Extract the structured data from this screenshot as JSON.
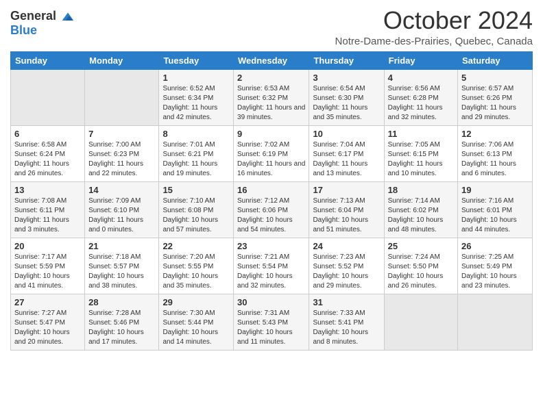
{
  "logo": {
    "general": "General",
    "blue": "Blue"
  },
  "title": "October 2024",
  "location": "Notre-Dame-des-Prairies, Quebec, Canada",
  "weekdays": [
    "Sunday",
    "Monday",
    "Tuesday",
    "Wednesday",
    "Thursday",
    "Friday",
    "Saturday"
  ],
  "weeks": [
    [
      {
        "day": "",
        "info": ""
      },
      {
        "day": "",
        "info": ""
      },
      {
        "day": "1",
        "info": "Sunrise: 6:52 AM\nSunset: 6:34 PM\nDaylight: 11 hours and 42 minutes."
      },
      {
        "day": "2",
        "info": "Sunrise: 6:53 AM\nSunset: 6:32 PM\nDaylight: 11 hours and 39 minutes."
      },
      {
        "day": "3",
        "info": "Sunrise: 6:54 AM\nSunset: 6:30 PM\nDaylight: 11 hours and 35 minutes."
      },
      {
        "day": "4",
        "info": "Sunrise: 6:56 AM\nSunset: 6:28 PM\nDaylight: 11 hours and 32 minutes."
      },
      {
        "day": "5",
        "info": "Sunrise: 6:57 AM\nSunset: 6:26 PM\nDaylight: 11 hours and 29 minutes."
      }
    ],
    [
      {
        "day": "6",
        "info": "Sunrise: 6:58 AM\nSunset: 6:24 PM\nDaylight: 11 hours and 26 minutes."
      },
      {
        "day": "7",
        "info": "Sunrise: 7:00 AM\nSunset: 6:23 PM\nDaylight: 11 hours and 22 minutes."
      },
      {
        "day": "8",
        "info": "Sunrise: 7:01 AM\nSunset: 6:21 PM\nDaylight: 11 hours and 19 minutes."
      },
      {
        "day": "9",
        "info": "Sunrise: 7:02 AM\nSunset: 6:19 PM\nDaylight: 11 hours and 16 minutes."
      },
      {
        "day": "10",
        "info": "Sunrise: 7:04 AM\nSunset: 6:17 PM\nDaylight: 11 hours and 13 minutes."
      },
      {
        "day": "11",
        "info": "Sunrise: 7:05 AM\nSunset: 6:15 PM\nDaylight: 11 hours and 10 minutes."
      },
      {
        "day": "12",
        "info": "Sunrise: 7:06 AM\nSunset: 6:13 PM\nDaylight: 11 hours and 6 minutes."
      }
    ],
    [
      {
        "day": "13",
        "info": "Sunrise: 7:08 AM\nSunset: 6:11 PM\nDaylight: 11 hours and 3 minutes."
      },
      {
        "day": "14",
        "info": "Sunrise: 7:09 AM\nSunset: 6:10 PM\nDaylight: 11 hours and 0 minutes."
      },
      {
        "day": "15",
        "info": "Sunrise: 7:10 AM\nSunset: 6:08 PM\nDaylight: 10 hours and 57 minutes."
      },
      {
        "day": "16",
        "info": "Sunrise: 7:12 AM\nSunset: 6:06 PM\nDaylight: 10 hours and 54 minutes."
      },
      {
        "day": "17",
        "info": "Sunrise: 7:13 AM\nSunset: 6:04 PM\nDaylight: 10 hours and 51 minutes."
      },
      {
        "day": "18",
        "info": "Sunrise: 7:14 AM\nSunset: 6:02 PM\nDaylight: 10 hours and 48 minutes."
      },
      {
        "day": "19",
        "info": "Sunrise: 7:16 AM\nSunset: 6:01 PM\nDaylight: 10 hours and 44 minutes."
      }
    ],
    [
      {
        "day": "20",
        "info": "Sunrise: 7:17 AM\nSunset: 5:59 PM\nDaylight: 10 hours and 41 minutes."
      },
      {
        "day": "21",
        "info": "Sunrise: 7:18 AM\nSunset: 5:57 PM\nDaylight: 10 hours and 38 minutes."
      },
      {
        "day": "22",
        "info": "Sunrise: 7:20 AM\nSunset: 5:55 PM\nDaylight: 10 hours and 35 minutes."
      },
      {
        "day": "23",
        "info": "Sunrise: 7:21 AM\nSunset: 5:54 PM\nDaylight: 10 hours and 32 minutes."
      },
      {
        "day": "24",
        "info": "Sunrise: 7:23 AM\nSunset: 5:52 PM\nDaylight: 10 hours and 29 minutes."
      },
      {
        "day": "25",
        "info": "Sunrise: 7:24 AM\nSunset: 5:50 PM\nDaylight: 10 hours and 26 minutes."
      },
      {
        "day": "26",
        "info": "Sunrise: 7:25 AM\nSunset: 5:49 PM\nDaylight: 10 hours and 23 minutes."
      }
    ],
    [
      {
        "day": "27",
        "info": "Sunrise: 7:27 AM\nSunset: 5:47 PM\nDaylight: 10 hours and 20 minutes."
      },
      {
        "day": "28",
        "info": "Sunrise: 7:28 AM\nSunset: 5:46 PM\nDaylight: 10 hours and 17 minutes."
      },
      {
        "day": "29",
        "info": "Sunrise: 7:30 AM\nSunset: 5:44 PM\nDaylight: 10 hours and 14 minutes."
      },
      {
        "day": "30",
        "info": "Sunrise: 7:31 AM\nSunset: 5:43 PM\nDaylight: 10 hours and 11 minutes."
      },
      {
        "day": "31",
        "info": "Sunrise: 7:33 AM\nSunset: 5:41 PM\nDaylight: 10 hours and 8 minutes."
      },
      {
        "day": "",
        "info": ""
      },
      {
        "day": "",
        "info": ""
      }
    ]
  ]
}
